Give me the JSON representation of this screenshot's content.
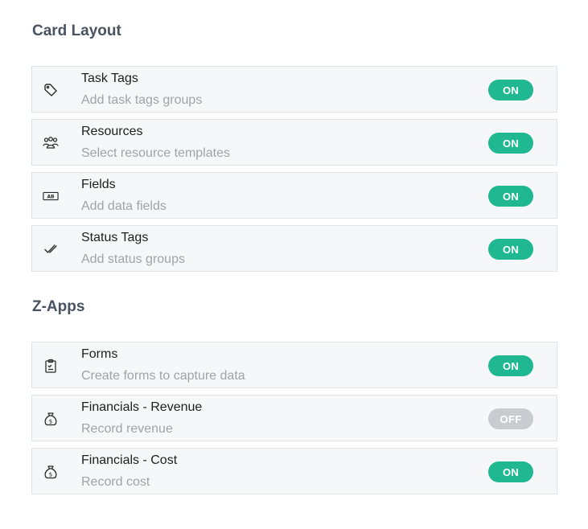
{
  "sections": [
    {
      "title": "Card Layout",
      "items": [
        {
          "icon": "tag-icon",
          "title": "Task Tags",
          "desc": "Add task tags groups",
          "toggle": "ON"
        },
        {
          "icon": "users-icon",
          "title": "Resources",
          "desc": "Select resource templates",
          "toggle": "ON"
        },
        {
          "icon": "fields-icon",
          "title": "Fields",
          "desc": "Add data fields",
          "toggle": "ON"
        },
        {
          "icon": "double-check-icon",
          "title": "Status Tags",
          "desc": "Add status groups",
          "toggle": "ON"
        }
      ]
    },
    {
      "title": "Z-Apps",
      "items": [
        {
          "icon": "clipboard-icon",
          "title": "Forms",
          "desc": "Create forms to capture data",
          "toggle": "ON"
        },
        {
          "icon": "money-bag-icon",
          "title": "Financials - Revenue",
          "desc": "Record revenue",
          "toggle": "OFF"
        },
        {
          "icon": "money-bag-icon",
          "title": "Financials - Cost",
          "desc": "Record cost",
          "toggle": "ON"
        }
      ]
    }
  ],
  "colors": {
    "toggle_on": "#1fb890",
    "toggle_off": "#c8cbd0",
    "section_title": "#4a5361",
    "row_bg": "#f6f7f9"
  }
}
